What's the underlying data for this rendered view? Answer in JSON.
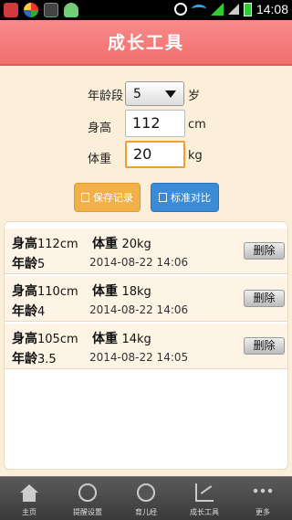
{
  "status_bar": {
    "time": "14:08"
  },
  "title": "成长工具",
  "form": {
    "age_label": "年龄段",
    "age_value": "5",
    "age_unit": "岁",
    "height_label": "身高",
    "height_value": "112",
    "height_unit": "cm",
    "weight_label": "体重",
    "weight_value": "20",
    "weight_unit": "kg"
  },
  "buttons": {
    "save": "保存记录",
    "compare": "标准对比"
  },
  "records": [
    {
      "height_label": "身高",
      "height": "112cm",
      "weight_label": "体重",
      "weight": "20kg",
      "age_label": "年龄",
      "age": "5",
      "date": "2014-08-22 14:06",
      "delete": "删除"
    },
    {
      "height_label": "身高",
      "height": "110cm",
      "weight_label": "体重",
      "weight": "18kg",
      "age_label": "年龄",
      "age": "4",
      "date": "2014-08-22 14:06",
      "delete": "删除"
    },
    {
      "height_label": "身高",
      "height": "105cm",
      "weight_label": "体重",
      "weight": "14kg",
      "age_label": "年龄",
      "age": "3.5",
      "date": "2014-08-22 14:05",
      "delete": "删除"
    }
  ],
  "nav": [
    {
      "label": "主页",
      "icon": "home-icon"
    },
    {
      "label": "提醒设置",
      "icon": "alarm-clock-icon"
    },
    {
      "label": "育儿经",
      "icon": "baby-face-icon"
    },
    {
      "label": "成长工具",
      "icon": "growth-chart-icon"
    },
    {
      "label": "更多",
      "icon": "more-dots-icon"
    }
  ]
}
